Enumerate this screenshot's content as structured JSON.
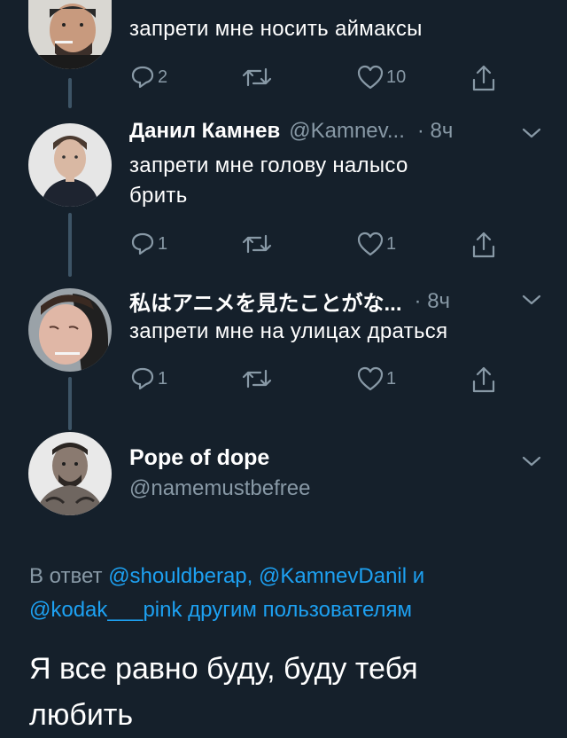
{
  "tweets": [
    {
      "text": "запрети мне носить аймаксы",
      "replies": "2",
      "retweets": "",
      "likes": "10"
    },
    {
      "name": "Данил Камнев",
      "handle": "@Kamnev...",
      "time": "· 8ч",
      "text_line1": "запрети мне голову налысо",
      "text_line2": "брить",
      "replies": "1",
      "likes": "1"
    },
    {
      "name": "私はアニメを見たことがな...",
      "time": "· 8ч",
      "text": "запрети мне на улицах драться",
      "replies": "1",
      "likes": "1"
    }
  ],
  "main_tweet": {
    "name": "Pope of dope",
    "handle": "@namemustbefree",
    "reply_prefix": "В ответ",
    "mention1": "@shouldberap,",
    "mention2": "@KamnevDanil",
    "conj": "и",
    "mention3": "@kodak___pink",
    "others": "другим пользователям",
    "text_line1": "Я все равно буду, буду тебя",
    "text_line2": "любить"
  },
  "icons": [
    "reply-icon",
    "retweet-icon",
    "like-icon",
    "share-icon",
    "chevron-down-icon"
  ],
  "colors": {
    "background": "#15202b",
    "muted": "#8899a6",
    "link": "#1da1f2",
    "thread_line": "#3d5466"
  }
}
